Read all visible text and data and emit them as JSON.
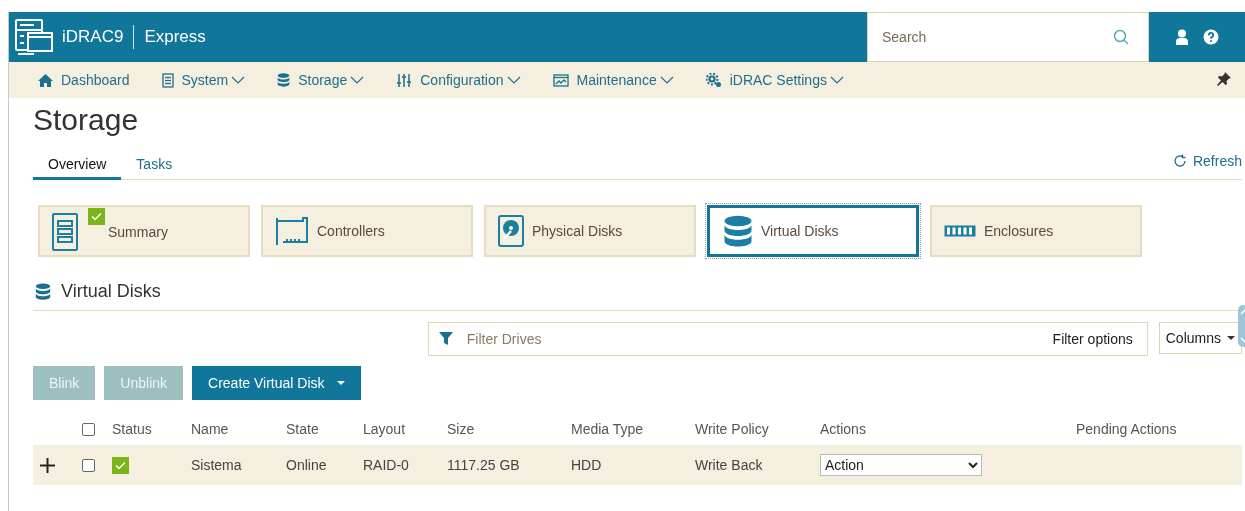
{
  "header": {
    "product": "iDRAC9",
    "edition": "Express",
    "search": {
      "placeholder": "Search"
    }
  },
  "nav": {
    "items": [
      {
        "label": "Dashboard",
        "has_menu": false
      },
      {
        "label": "System",
        "has_menu": true
      },
      {
        "label": "Storage",
        "has_menu": true
      },
      {
        "label": "Configuration",
        "has_menu": true
      },
      {
        "label": "Maintenance",
        "has_menu": true
      },
      {
        "label": "iDRAC Settings",
        "has_menu": true
      }
    ]
  },
  "page": {
    "title": "Storage",
    "refresh": "Refresh"
  },
  "tabs": [
    {
      "label": "Overview",
      "selected": true
    },
    {
      "label": "Tasks",
      "selected": false
    }
  ],
  "cards": [
    {
      "label": "Summary",
      "selected": false,
      "status_ok": true
    },
    {
      "label": "Controllers",
      "selected": false,
      "status_ok": false
    },
    {
      "label": "Physical Disks",
      "selected": false,
      "status_ok": false
    },
    {
      "label": "Virtual Disks",
      "selected": true,
      "status_ok": false
    },
    {
      "label": "Enclosures",
      "selected": false,
      "status_ok": false
    }
  ],
  "section": {
    "title": "Virtual Disks"
  },
  "filter": {
    "placeholder": "Filter Drives",
    "options": "Filter options",
    "columns": "Columns"
  },
  "buttons": [
    {
      "label": "Blink",
      "disabled": true,
      "menu": false
    },
    {
      "label": "Unblink",
      "disabled": true,
      "menu": false
    },
    {
      "label": "Create Virtual Disk",
      "disabled": false,
      "menu": true
    }
  ],
  "table": {
    "all_checked": false,
    "columns": [
      "Status",
      "Name",
      "State",
      "Layout",
      "Size",
      "Media Type",
      "Write Policy",
      "Actions",
      "Pending Actions"
    ],
    "rows": [
      {
        "expanded": false,
        "checked": false,
        "status_ok": true,
        "name": "Sistema",
        "state": "Online",
        "layout": "RAID-0",
        "size": "1117.25 GB",
        "media_type": "HDD",
        "write_policy": "Write Back",
        "action": "Action"
      }
    ]
  }
}
